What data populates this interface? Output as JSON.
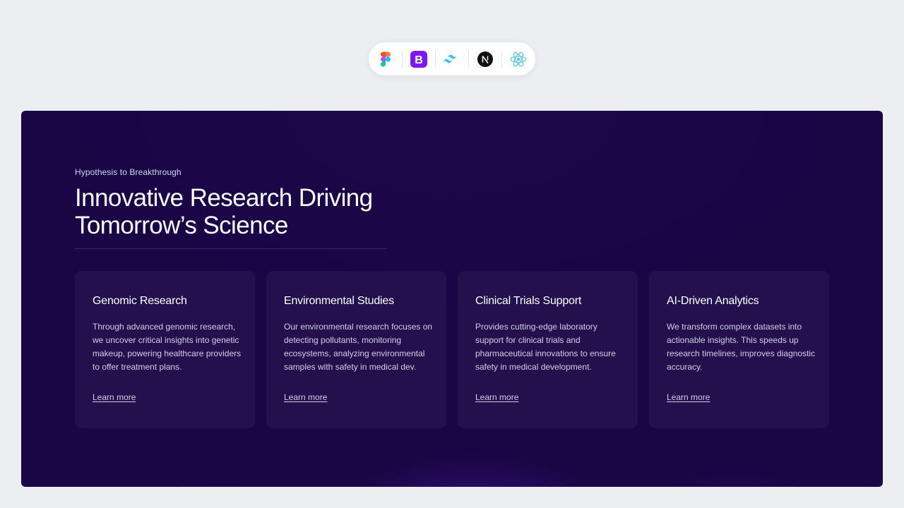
{
  "tech_icons": [
    {
      "name": "figma-icon"
    },
    {
      "name": "bootstrap-icon"
    },
    {
      "name": "tailwind-icon"
    },
    {
      "name": "nextjs-icon"
    },
    {
      "name": "react-icon"
    }
  ],
  "hero": {
    "eyebrow": "Hypothesis to Breakthrough",
    "headline_line1": "Innovative Research Driving",
    "headline_line2": "Tomorrow’s Science"
  },
  "cards": [
    {
      "title": "Genomic Research",
      "description": "Through advanced genomic research, we uncover critical insights into genetic makeup, powering healthcare providers to offer treatment plans.",
      "link": "Learn more"
    },
    {
      "title": "Environmental Studies",
      "description": "Our environmental research focuses on detecting pollutants, monitoring ecosystems, analyzing environmental samples with safety in medical dev.",
      "link": "Learn more"
    },
    {
      "title": "Clinical Trials Support",
      "description": "Provides cutting-edge laboratory support for clinical trials and pharmaceutical innovations to ensure safety in medical development.",
      "link": "Learn more"
    },
    {
      "title": "AI-Driven Analytics",
      "description": "We transform complex datasets into actionable insights. This speeds up research timelines, improves diagnostic accuracy.",
      "link": "Learn more"
    }
  ],
  "colors": {
    "page_bg": "#eceef1",
    "hero_bg": "#1a0645",
    "accent_glow": "#4b1eb4",
    "bootstrap": "#7b18f3",
    "tailwind": "#38bdf8",
    "react": "#58c4dc"
  }
}
